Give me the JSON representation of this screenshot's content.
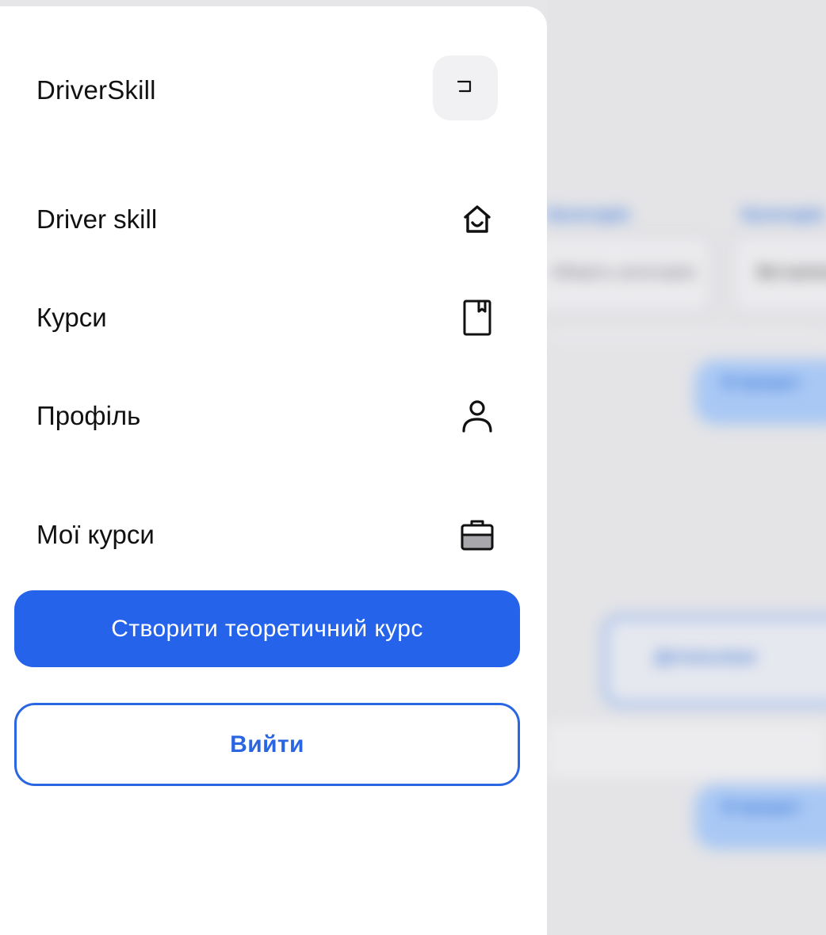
{
  "drawer": {
    "brand": "DriverSkill",
    "collapse_icon": "collapse-icon",
    "nav": [
      {
        "label": "Driver skill",
        "icon": "home-icon"
      },
      {
        "label": "Курси",
        "icon": "book-icon"
      },
      {
        "label": "Профіль",
        "icon": "user-icon"
      },
      {
        "label": "Мої курси",
        "icon": "briefcase-icon"
      }
    ],
    "create_course_label": "Створити теоретичний курс",
    "logout_label": "Вийти",
    "accent_color": "#2563eb"
  },
  "background": {
    "filter_label_1": "Категорія",
    "filter_label_2": "Категорія",
    "filter_value_1": "Оберіть категорію",
    "filter_value_2": "Всі категорії",
    "pill_1": "В процесі",
    "details_button": "Детальніше",
    "pill_2": "В процесі"
  }
}
